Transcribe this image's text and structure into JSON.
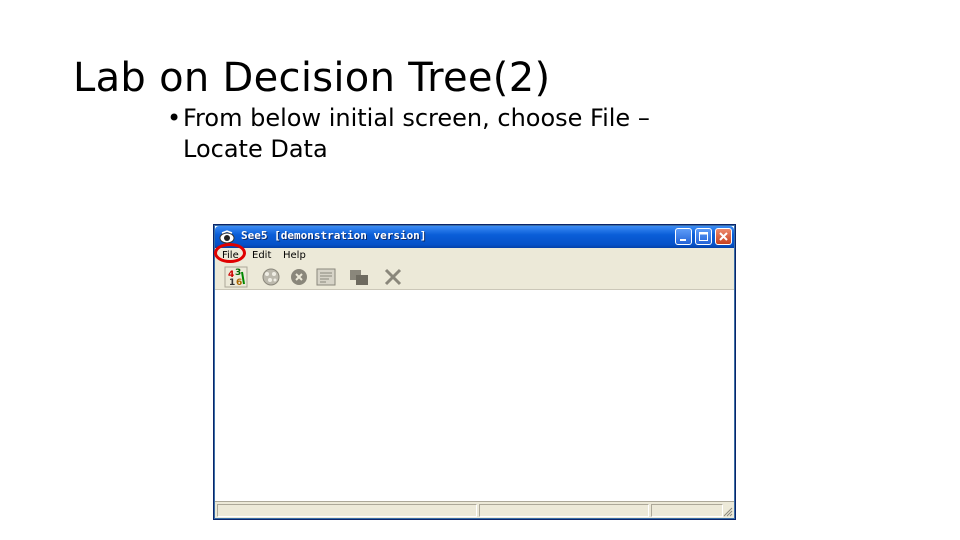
{
  "slide": {
    "title": "Lab on Decision Tree(2)",
    "bullet": "From below initial screen, choose File – Locate Data",
    "bullet_marker": "•"
  },
  "window": {
    "title": "See5 [demonstration version]",
    "controls": [
      "minimize-icon",
      "maximize-icon",
      "close-icon"
    ],
    "menu": [
      {
        "label": "File"
      },
      {
        "label": "Edit"
      },
      {
        "label": "Help"
      }
    ],
    "toolbar_icons": [
      "locate-data-icon",
      "construct-classifier-icon",
      "stop-icon",
      "review-output-icon",
      "use-classifier-icon",
      "cross-reference-icon"
    ],
    "highlight_color": "#e00000",
    "titlebar_color": "#0a5ed8"
  }
}
